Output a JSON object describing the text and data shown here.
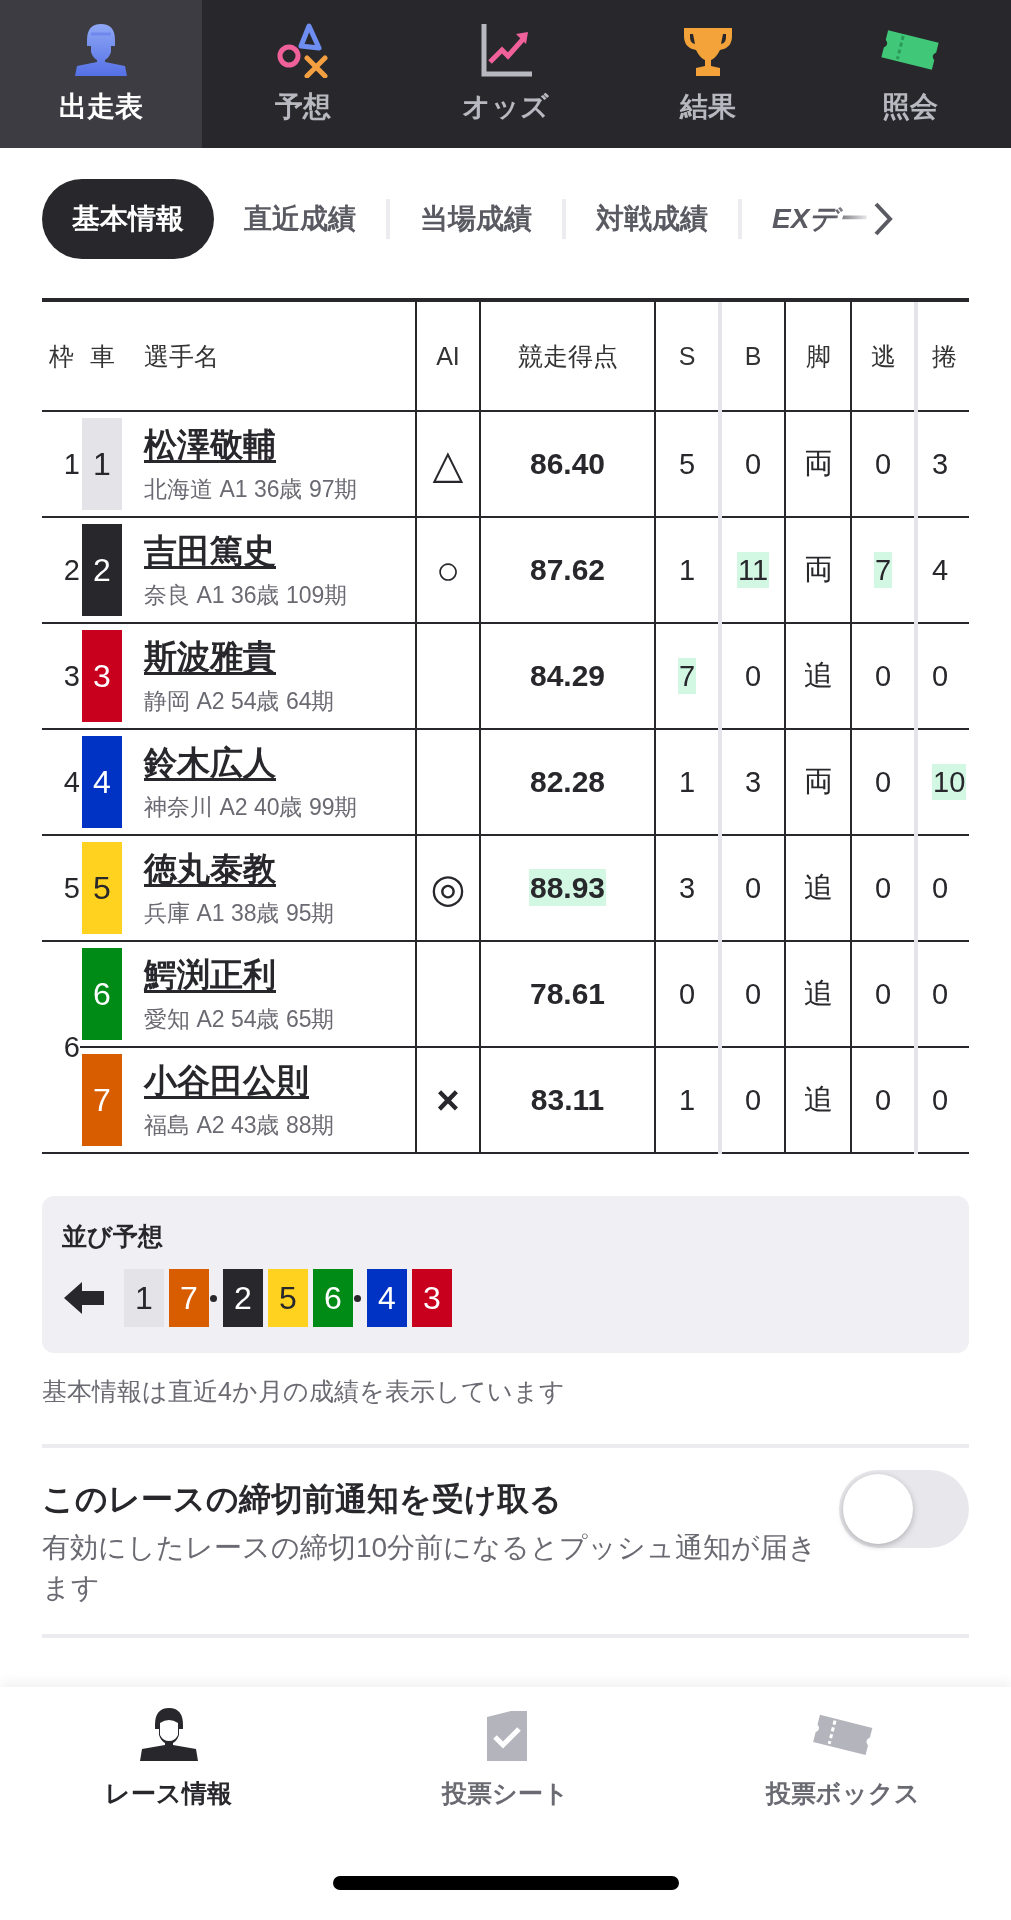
{
  "top_tabs": [
    {
      "label": "出走表",
      "selected": true
    },
    {
      "label": "予想",
      "selected": false
    },
    {
      "label": "オッズ",
      "selected": false
    },
    {
      "label": "結果",
      "selected": false
    },
    {
      "label": "照会",
      "selected": false
    }
  ],
  "sub_tabs": [
    {
      "label": "基本情報",
      "selected": true
    },
    {
      "label": "直近成績",
      "selected": false
    },
    {
      "label": "当場成績",
      "selected": false
    },
    {
      "label": "対戦成績",
      "selected": false
    },
    {
      "label": "EXデー",
      "selected": false
    }
  ],
  "table": {
    "columns": [
      "枠",
      "車",
      "選手名",
      "AI",
      "競走得点",
      "S",
      "B",
      "脚",
      "逃",
      "捲"
    ],
    "rows": [
      {
        "frame": "1",
        "car": "1",
        "color": "#e4e4e8",
        "name": "松澤敬輔",
        "info": "北海道 A1 36歳 97期",
        "ai": "△",
        "score": {
          "value": "86.40",
          "highlight": false
        },
        "stats": [
          {
            "value": "5",
            "highlight": false
          },
          {
            "value": "0",
            "highlight": false
          },
          {
            "value": "両",
            "highlight": false
          },
          {
            "value": "0",
            "highlight": false
          },
          {
            "value": "3",
            "highlight": false
          }
        ]
      },
      {
        "frame": "2",
        "car": "2",
        "color": "#28282c",
        "name": "吉田篤史",
        "info": "奈良 A1 36歳 109期",
        "ai": "○",
        "score": {
          "value": "87.62",
          "highlight": false
        },
        "stats": [
          {
            "value": "1",
            "highlight": false
          },
          {
            "value": "11",
            "highlight": true
          },
          {
            "value": "両",
            "highlight": false
          },
          {
            "value": "7",
            "highlight": true
          },
          {
            "value": "4",
            "highlight": false
          }
        ]
      },
      {
        "frame": "3",
        "car": "3",
        "color": "#c8001e",
        "name": "斯波雅貴",
        "info": "静岡 A2 54歳 64期",
        "score": {
          "value": "84.29",
          "highlight": false
        },
        "stats": [
          {
            "value": "7",
            "highlight": true
          },
          {
            "value": "0",
            "highlight": false
          },
          {
            "value": "追",
            "highlight": false
          },
          {
            "value": "0",
            "highlight": false
          },
          {
            "value": "0",
            "highlight": false
          }
        ]
      },
      {
        "frame": "4",
        "car": "4",
        "color": "#0033c4",
        "name": "鈴木広人",
        "info": "神奈川 A2 40歳 99期",
        "score": {
          "value": "82.28",
          "highlight": false
        },
        "stats": [
          {
            "value": "1",
            "highlight": false
          },
          {
            "value": "3",
            "highlight": false
          },
          {
            "value": "両",
            "highlight": false
          },
          {
            "value": "0",
            "highlight": false
          },
          {
            "value": "10",
            "highlight": true
          }
        ]
      },
      {
        "frame": "5",
        "car": "5",
        "color": "#ffd21f",
        "name": "徳丸泰教",
        "info": "兵庫 A1 38歳 95期",
        "ai": "◎",
        "score": {
          "value": "88.93",
          "highlight": true
        },
        "stats": [
          {
            "value": "3",
            "highlight": false
          },
          {
            "value": "0",
            "highlight": false
          },
          {
            "value": "追",
            "highlight": false
          },
          {
            "value": "0",
            "highlight": false
          },
          {
            "value": "0",
            "highlight": false
          }
        ]
      },
      {
        "frame": "6",
        "car": "6",
        "color": "#008a16",
        "name": "鰐渕正利",
        "info": "愛知 A2 54歳 65期",
        "score": {
          "value": "78.61",
          "highlight": false
        },
        "stats": [
          {
            "value": "0",
            "highlight": false
          },
          {
            "value": "0",
            "highlight": false
          },
          {
            "value": "追",
            "highlight": false
          },
          {
            "value": "0",
            "highlight": false
          },
          {
            "value": "0",
            "highlight": false
          }
        ]
      },
      {
        "car": "7",
        "color": "#d85c00",
        "name": "小谷田公則",
        "info": "福島 A2 43歳 88期",
        "ai": "×",
        "score": {
          "value": "83.11",
          "highlight": false
        },
        "stats": [
          {
            "value": "1",
            "highlight": false
          },
          {
            "value": "0",
            "highlight": false
          },
          {
            "value": "追",
            "highlight": false
          },
          {
            "value": "0",
            "highlight": false
          },
          {
            "value": "0",
            "highlight": false
          }
        ]
      }
    ]
  },
  "lineup": {
    "title": "並び予想",
    "groups": [
      [
        {
          "car": "1",
          "color": "#e4e4e8"
        },
        {
          "car": "7",
          "color": "#d85c00"
        }
      ],
      [
        {
          "car": "2",
          "color": "#28282c"
        },
        {
          "car": "5",
          "color": "#ffd21f"
        },
        {
          "car": "6",
          "color": "#008a16"
        }
      ],
      [
        {
          "car": "4",
          "color": "#0033c4"
        },
        {
          "car": "3",
          "color": "#c8001e"
        }
      ]
    ]
  },
  "note": "基本情報は直近4か月の成績を表示しています",
  "notification": {
    "title": "このレースの締切前通知を受け取る",
    "description": "有効にしたレースの締切10分前になるとプッシュ通知が届きます",
    "on": false
  },
  "bottom_nav": [
    {
      "label": "レース情報",
      "selected": true
    },
    {
      "label": "投票シート",
      "selected": false
    },
    {
      "label": "投票ボックス",
      "selected": false
    }
  ]
}
